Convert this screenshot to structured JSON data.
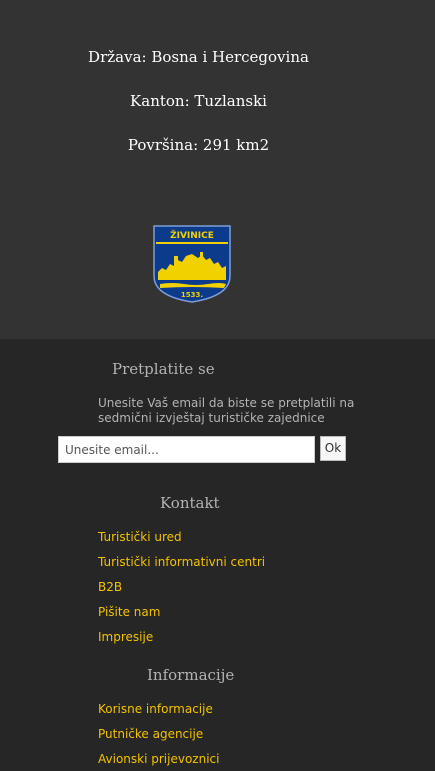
{
  "info": {
    "country": "Država: Bosna i Hercegovina",
    "canton": "Kanton: Tuzlanski",
    "area": "Površina: 291 km2",
    "crest": {
      "banner": "ŽIVINICE",
      "year": "1533.",
      "colors": {
        "shield": "#0d3b8c",
        "gold": "#f2d100"
      }
    }
  },
  "subscribe": {
    "heading": "Pretplatite se",
    "description": "Unesite Vaš email da biste se pretplatili na sedmični izvještaj turističke zajednice",
    "email_placeholder": "Unesite email...",
    "ok_label": "Ok"
  },
  "contact": {
    "heading": "Kontakt",
    "links": [
      "Turistički ured",
      "Turistički informativni centri",
      "B2B",
      "Pišite nam",
      "Impresije"
    ]
  },
  "information": {
    "heading": "Informacije",
    "links": [
      "Korisne informacije",
      "Putničke agencije",
      "Avionski prijevoznici"
    ]
  },
  "colors": {
    "info_background": "#333333",
    "footer_background": "#262626",
    "link": "#f2c200",
    "heading": "#b3b3b3"
  }
}
